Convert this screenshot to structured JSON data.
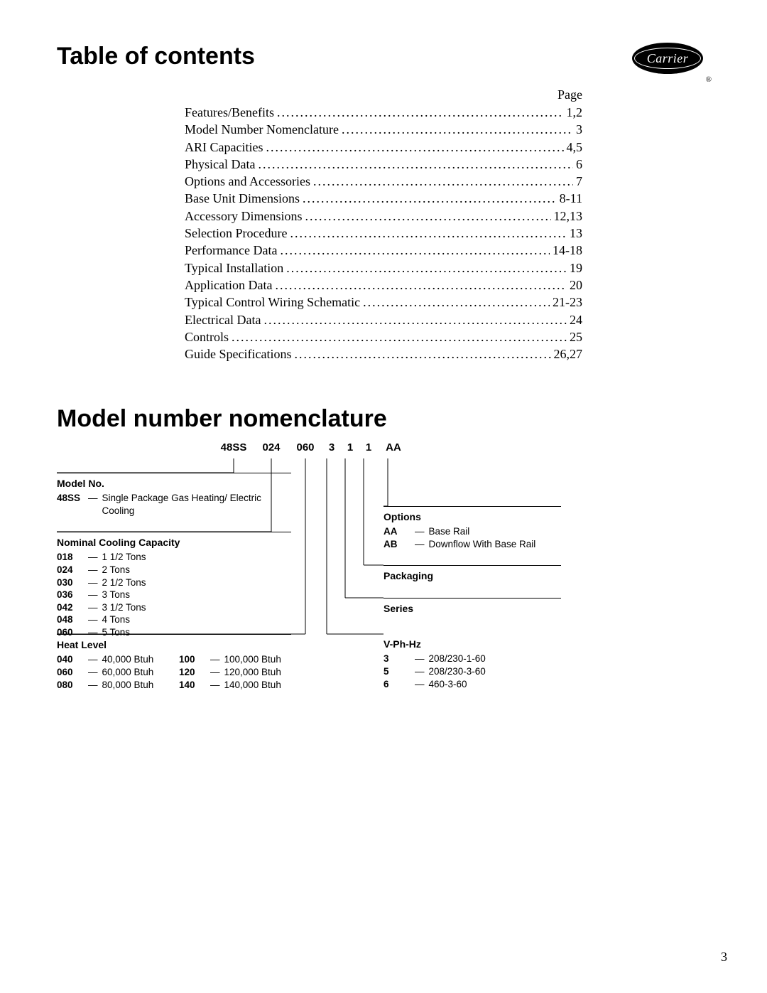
{
  "logo": {
    "brand": "Carrier",
    "reg": "®"
  },
  "toc": {
    "heading": "Table of contents",
    "page_label": "Page",
    "rows": [
      {
        "label": "Features/Benefits",
        "pg": "1,2"
      },
      {
        "label": "Model Number Nomenclature",
        "pg": "3"
      },
      {
        "label": "ARI Capacities",
        "pg": "4,5"
      },
      {
        "label": "Physical Data",
        "pg": "6"
      },
      {
        "label": "Options and Accessories",
        "pg": "7"
      },
      {
        "label": "Base Unit Dimensions",
        "pg": "8-11"
      },
      {
        "label": "Accessory Dimensions",
        "pg": "12,13"
      },
      {
        "label": "Selection Procedure",
        "pg": "13"
      },
      {
        "label": "Performance Data",
        "pg": "14-18"
      },
      {
        "label": "Typical Installation",
        "pg": "19"
      },
      {
        "label": "Application Data",
        "pg": "20"
      },
      {
        "label": "Typical Control Wiring Schematic",
        "pg": "21-23"
      },
      {
        "label": "Electrical Data",
        "pg": "24"
      },
      {
        "label": "Controls",
        "pg": "25"
      },
      {
        "label": "Guide Specifications",
        "pg": "26,27"
      }
    ]
  },
  "nomen": {
    "heading": "Model number nomenclature",
    "codes": {
      "model": "48SS",
      "cool": "024",
      "heat": "060",
      "vph": "3",
      "series": "1",
      "pkg": "1",
      "opts": "AA"
    },
    "model_box": {
      "title": "Model No.",
      "items": [
        {
          "code": "48SS",
          "dash": "—",
          "desc": "Single Package Gas Heating/ Electric Cooling"
        }
      ]
    },
    "cooling_box": {
      "title": "Nominal Cooling Capacity",
      "items": [
        {
          "code": "018",
          "dash": "—",
          "desc": "1 1/2 Tons"
        },
        {
          "code": "024",
          "dash": "—",
          "desc": "2 Tons"
        },
        {
          "code": "030",
          "dash": "—",
          "desc": "2 1/2 Tons"
        },
        {
          "code": "036",
          "dash": "—",
          "desc": "3 Tons"
        },
        {
          "code": "042",
          "dash": "—",
          "desc": "3 1/2 Tons"
        },
        {
          "code": "048",
          "dash": "—",
          "desc": "4 Tons"
        },
        {
          "code": "060",
          "dash": "—",
          "desc": "5 Tons"
        }
      ]
    },
    "heat_box": {
      "title": "Heat Level",
      "col1": [
        {
          "code": "040",
          "dash": "—",
          "desc": "40,000 Btuh"
        },
        {
          "code": "060",
          "dash": "—",
          "desc": "60,000 Btuh"
        },
        {
          "code": "080",
          "dash": "—",
          "desc": "80,000 Btuh"
        }
      ],
      "col2": [
        {
          "code": "100",
          "dash": "—",
          "desc": "100,000 Btuh"
        },
        {
          "code": "120",
          "dash": "—",
          "desc": "120,000 Btuh"
        },
        {
          "code": "140",
          "dash": "—",
          "desc": "140,000 Btuh"
        }
      ]
    },
    "options_box": {
      "title": "Options",
      "items": [
        {
          "code": "AA",
          "dash": "—",
          "desc": "Base Rail"
        },
        {
          "code": "AB",
          "dash": "—",
          "desc": "Downflow With Base Rail"
        }
      ]
    },
    "packaging_box": {
      "title": "Packaging"
    },
    "series_box": {
      "title": "Series"
    },
    "vph_box": {
      "title": "V-Ph-Hz",
      "items": [
        {
          "code": "3",
          "dash": "—",
          "desc": "208/230-1-60"
        },
        {
          "code": "5",
          "dash": "—",
          "desc": "208/230-3-60"
        },
        {
          "code": "6",
          "dash": "—",
          "desc": "460-3-60"
        }
      ]
    }
  },
  "page_number": "3"
}
